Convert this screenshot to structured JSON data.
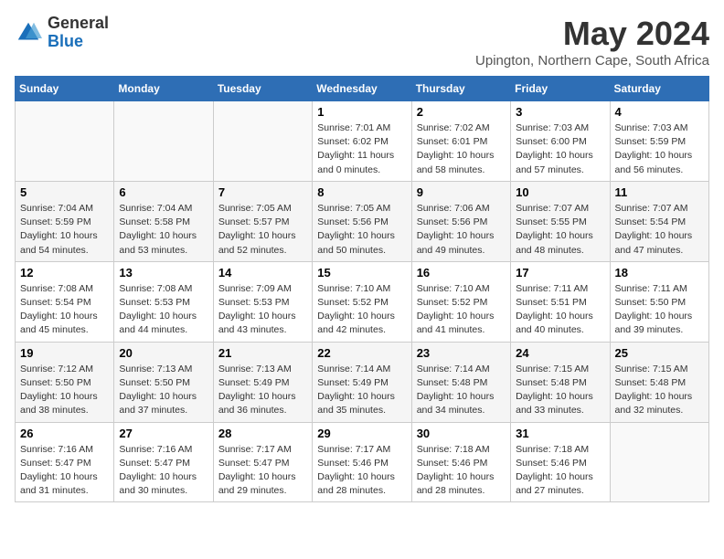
{
  "logo": {
    "general": "General",
    "blue": "Blue"
  },
  "title": "May 2024",
  "location": "Upington, Northern Cape, South Africa",
  "days_of_week": [
    "Sunday",
    "Monday",
    "Tuesday",
    "Wednesday",
    "Thursday",
    "Friday",
    "Saturday"
  ],
  "weeks": [
    [
      {
        "day": "",
        "info": ""
      },
      {
        "day": "",
        "info": ""
      },
      {
        "day": "",
        "info": ""
      },
      {
        "day": "1",
        "info": "Sunrise: 7:01 AM\nSunset: 6:02 PM\nDaylight: 11 hours and 0 minutes."
      },
      {
        "day": "2",
        "info": "Sunrise: 7:02 AM\nSunset: 6:01 PM\nDaylight: 10 hours and 58 minutes."
      },
      {
        "day": "3",
        "info": "Sunrise: 7:03 AM\nSunset: 6:00 PM\nDaylight: 10 hours and 57 minutes."
      },
      {
        "day": "4",
        "info": "Sunrise: 7:03 AM\nSunset: 5:59 PM\nDaylight: 10 hours and 56 minutes."
      }
    ],
    [
      {
        "day": "5",
        "info": "Sunrise: 7:04 AM\nSunset: 5:59 PM\nDaylight: 10 hours and 54 minutes."
      },
      {
        "day": "6",
        "info": "Sunrise: 7:04 AM\nSunset: 5:58 PM\nDaylight: 10 hours and 53 minutes."
      },
      {
        "day": "7",
        "info": "Sunrise: 7:05 AM\nSunset: 5:57 PM\nDaylight: 10 hours and 52 minutes."
      },
      {
        "day": "8",
        "info": "Sunrise: 7:05 AM\nSunset: 5:56 PM\nDaylight: 10 hours and 50 minutes."
      },
      {
        "day": "9",
        "info": "Sunrise: 7:06 AM\nSunset: 5:56 PM\nDaylight: 10 hours and 49 minutes."
      },
      {
        "day": "10",
        "info": "Sunrise: 7:07 AM\nSunset: 5:55 PM\nDaylight: 10 hours and 48 minutes."
      },
      {
        "day": "11",
        "info": "Sunrise: 7:07 AM\nSunset: 5:54 PM\nDaylight: 10 hours and 47 minutes."
      }
    ],
    [
      {
        "day": "12",
        "info": "Sunrise: 7:08 AM\nSunset: 5:54 PM\nDaylight: 10 hours and 45 minutes."
      },
      {
        "day": "13",
        "info": "Sunrise: 7:08 AM\nSunset: 5:53 PM\nDaylight: 10 hours and 44 minutes."
      },
      {
        "day": "14",
        "info": "Sunrise: 7:09 AM\nSunset: 5:53 PM\nDaylight: 10 hours and 43 minutes."
      },
      {
        "day": "15",
        "info": "Sunrise: 7:10 AM\nSunset: 5:52 PM\nDaylight: 10 hours and 42 minutes."
      },
      {
        "day": "16",
        "info": "Sunrise: 7:10 AM\nSunset: 5:52 PM\nDaylight: 10 hours and 41 minutes."
      },
      {
        "day": "17",
        "info": "Sunrise: 7:11 AM\nSunset: 5:51 PM\nDaylight: 10 hours and 40 minutes."
      },
      {
        "day": "18",
        "info": "Sunrise: 7:11 AM\nSunset: 5:50 PM\nDaylight: 10 hours and 39 minutes."
      }
    ],
    [
      {
        "day": "19",
        "info": "Sunrise: 7:12 AM\nSunset: 5:50 PM\nDaylight: 10 hours and 38 minutes."
      },
      {
        "day": "20",
        "info": "Sunrise: 7:13 AM\nSunset: 5:50 PM\nDaylight: 10 hours and 37 minutes."
      },
      {
        "day": "21",
        "info": "Sunrise: 7:13 AM\nSunset: 5:49 PM\nDaylight: 10 hours and 36 minutes."
      },
      {
        "day": "22",
        "info": "Sunrise: 7:14 AM\nSunset: 5:49 PM\nDaylight: 10 hours and 35 minutes."
      },
      {
        "day": "23",
        "info": "Sunrise: 7:14 AM\nSunset: 5:48 PM\nDaylight: 10 hours and 34 minutes."
      },
      {
        "day": "24",
        "info": "Sunrise: 7:15 AM\nSunset: 5:48 PM\nDaylight: 10 hours and 33 minutes."
      },
      {
        "day": "25",
        "info": "Sunrise: 7:15 AM\nSunset: 5:48 PM\nDaylight: 10 hours and 32 minutes."
      }
    ],
    [
      {
        "day": "26",
        "info": "Sunrise: 7:16 AM\nSunset: 5:47 PM\nDaylight: 10 hours and 31 minutes."
      },
      {
        "day": "27",
        "info": "Sunrise: 7:16 AM\nSunset: 5:47 PM\nDaylight: 10 hours and 30 minutes."
      },
      {
        "day": "28",
        "info": "Sunrise: 7:17 AM\nSunset: 5:47 PM\nDaylight: 10 hours and 29 minutes."
      },
      {
        "day": "29",
        "info": "Sunrise: 7:17 AM\nSunset: 5:46 PM\nDaylight: 10 hours and 28 minutes."
      },
      {
        "day": "30",
        "info": "Sunrise: 7:18 AM\nSunset: 5:46 PM\nDaylight: 10 hours and 28 minutes."
      },
      {
        "day": "31",
        "info": "Sunrise: 7:18 AM\nSunset: 5:46 PM\nDaylight: 10 hours and 27 minutes."
      },
      {
        "day": "",
        "info": ""
      }
    ]
  ]
}
